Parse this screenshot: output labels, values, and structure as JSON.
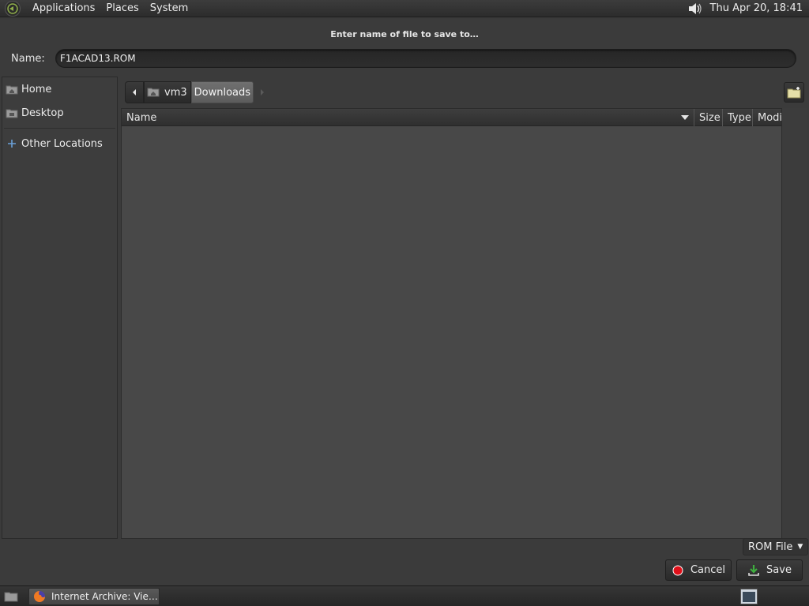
{
  "top_panel": {
    "menus": [
      "Applications",
      "Places",
      "System"
    ],
    "clock": "Thu Apr 20, 18:41"
  },
  "dialog": {
    "title": "Enter name of file to save to…",
    "name_label": "Name:",
    "name_value": "F1ACAD13.ROM",
    "sidebar": {
      "items": [
        {
          "label": "Home",
          "icon": "home-folder-icon"
        },
        {
          "label": "Desktop",
          "icon": "desktop-folder-icon"
        },
        {
          "label": "Other Locations",
          "icon": "plus-icon"
        }
      ]
    },
    "pathbar": {
      "segments": [
        "vm3",
        "Downloads"
      ],
      "active": "Downloads"
    },
    "columns": {
      "name": "Name",
      "size": "Size",
      "type": "Type",
      "modified": "Modifi"
    },
    "filter": "ROM File",
    "buttons": {
      "cancel": "Cancel",
      "save": "Save"
    }
  },
  "taskbar": {
    "task_label": "Internet Archive: Vie…"
  },
  "colors": {
    "background": "#3a3a3a",
    "list_background": "#484848",
    "active_segment": "#666666",
    "cancel_red": "#e0101a",
    "save_green": "#3fae3f"
  }
}
